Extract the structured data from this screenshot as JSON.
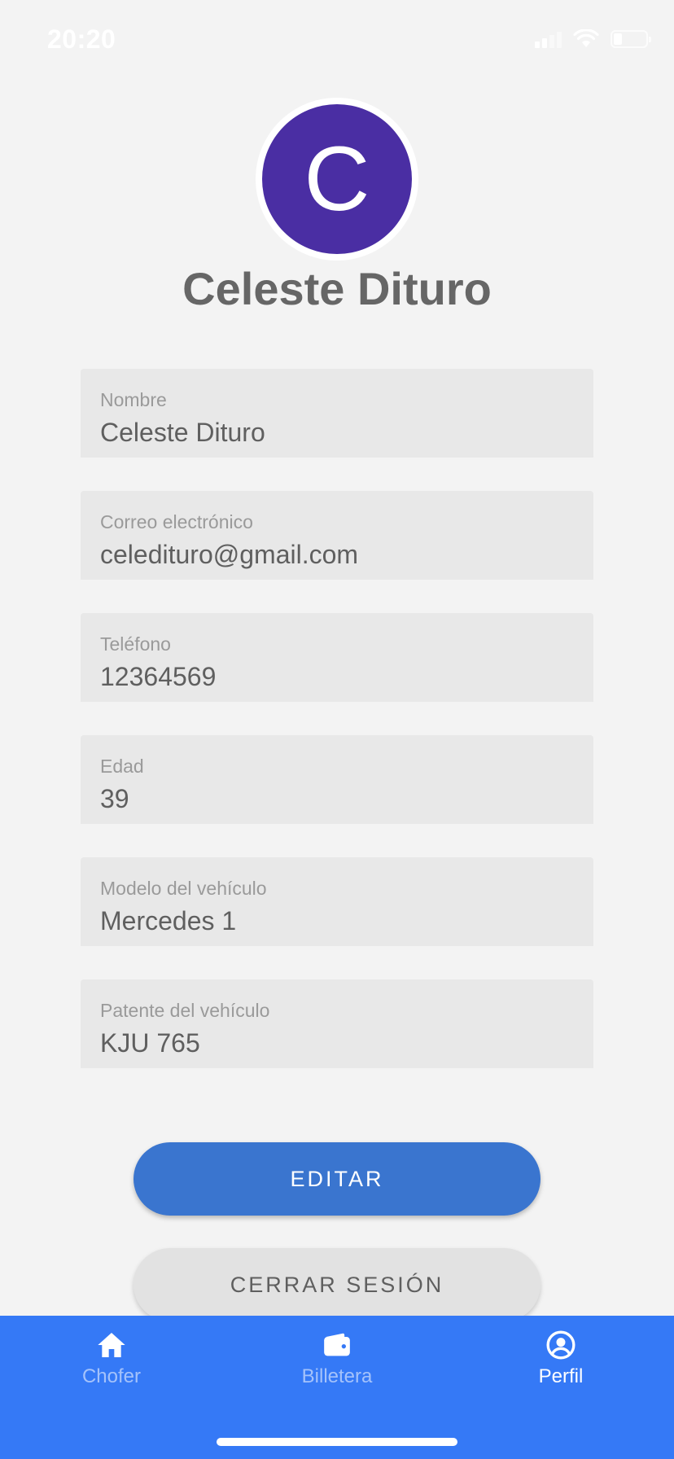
{
  "status_bar": {
    "time": "20:20",
    "battery_level": 0.25
  },
  "profile": {
    "avatar_initial": "C",
    "avatar_color": "#4a2ea3",
    "name": "Celeste Dituro"
  },
  "fields": [
    {
      "label": "Nombre",
      "value": "Celeste Dituro"
    },
    {
      "label": "Correo electrónico",
      "value": "celedituro@gmail.com"
    },
    {
      "label": "Teléfono",
      "value": "12364569"
    },
    {
      "label": "Edad",
      "value": "39"
    },
    {
      "label": "Modelo del vehículo",
      "value": "Mercedes 1"
    },
    {
      "label": "Patente del vehículo",
      "value": "KJU 765"
    }
  ],
  "actions": {
    "edit_label": "EDITAR",
    "logout_label": "CERRAR SESIÓN"
  },
  "bottom_nav": {
    "items": [
      {
        "label": "Chofer",
        "icon": "home-icon",
        "active": false
      },
      {
        "label": "Billetera",
        "icon": "wallet-icon",
        "active": false
      },
      {
        "label": "Perfil",
        "icon": "account-circle-icon",
        "active": true
      }
    ]
  },
  "colors": {
    "primary": "#3a75cf",
    "nav_background": "#3579f6",
    "background": "#f3f3f3"
  }
}
